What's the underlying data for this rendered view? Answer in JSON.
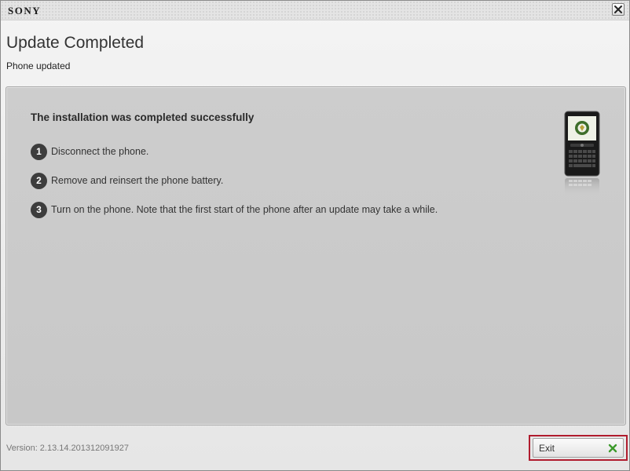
{
  "titlebar": {
    "logo_text": "SONY",
    "close_icon": "close-icon"
  },
  "header": {
    "title": "Update Completed",
    "subtitle": "Phone updated"
  },
  "panel": {
    "heading": "The installation was completed successfully",
    "steps": [
      {
        "number": "1",
        "text": "Disconnect the phone."
      },
      {
        "number": "2",
        "text": "Remove and reinsert the phone battery."
      },
      {
        "number": "3",
        "text": "Turn on the phone. Note that the first start of the phone after an update may take a while."
      }
    ],
    "phone_image": "phone-icon"
  },
  "footer": {
    "version": "Version: 2.13.14.201312091927",
    "exit_label": "Exit",
    "exit_icon": "green-x-icon"
  },
  "colors": {
    "highlight": "#b01c2e",
    "exit_icon": "#3c9a2b",
    "step_badge": "#3d3d3d"
  }
}
